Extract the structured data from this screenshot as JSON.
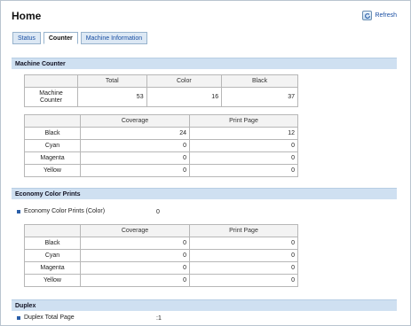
{
  "header": {
    "title": "Home",
    "refresh_label": "Refresh"
  },
  "tabs": [
    {
      "label": "Status",
      "active": false
    },
    {
      "label": "Counter",
      "active": true
    },
    {
      "label": "Machine Information",
      "active": false
    }
  ],
  "machine_counter": {
    "section_title": "Machine Counter",
    "summary": {
      "headers": [
        "",
        "Total",
        "Color",
        "Black"
      ],
      "row_label": "Machine Counter",
      "values": [
        "53",
        "16",
        "37"
      ]
    },
    "detail": {
      "headers": [
        "",
        "Coverage",
        "Print Page"
      ],
      "rows": [
        {
          "label": "Black",
          "coverage": "24",
          "print_page": "12"
        },
        {
          "label": "Cyan",
          "coverage": "0",
          "print_page": "0"
        },
        {
          "label": "Magenta",
          "coverage": "0",
          "print_page": "0"
        },
        {
          "label": "Yellow",
          "coverage": "0",
          "print_page": "0"
        }
      ]
    }
  },
  "economy": {
    "section_title": "Economy Color Prints",
    "bullet_label": "Economy Color Prints (Color)",
    "bullet_value": "0",
    "detail": {
      "headers": [
        "",
        "Coverage",
        "Print Page"
      ],
      "rows": [
        {
          "label": "Black",
          "coverage": "0",
          "print_page": "0"
        },
        {
          "label": "Cyan",
          "coverage": "0",
          "print_page": "0"
        },
        {
          "label": "Magenta",
          "coverage": "0",
          "print_page": "0"
        },
        {
          "label": "Yellow",
          "coverage": "0",
          "print_page": "0"
        }
      ]
    }
  },
  "duplex": {
    "section_title": "Duplex",
    "bullet_label": "Duplex Total Page",
    "bullet_value": ":1"
  },
  "colors": {
    "section_bg": "#cfe0f1",
    "tab_bg": "#dce8f4",
    "link": "#1a4fa3"
  }
}
